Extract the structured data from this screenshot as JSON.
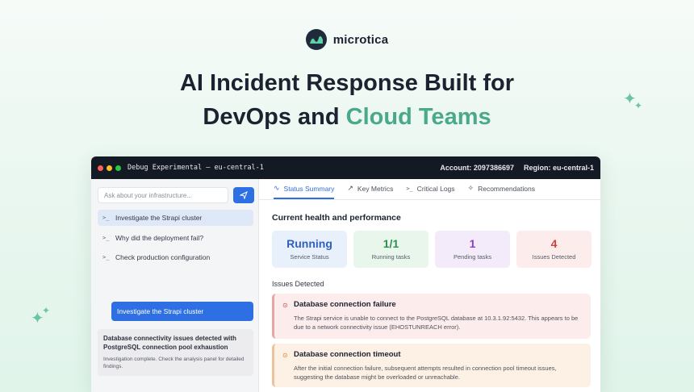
{
  "brand": {
    "name": "microtica"
  },
  "hero": {
    "line1": "AI Incident Response Built for",
    "line2_plain": "DevOps and ",
    "line2_accent": "Cloud Teams"
  },
  "colors": {
    "accent": "#4aa98a",
    "primary_blue": "#2f6fe4",
    "titlebar": "#141a24"
  },
  "window": {
    "title": "Debug Experimental — eu-central-1",
    "account": "Account: 2097386697",
    "region": "Region: eu-central-1",
    "traffic_lights": [
      "#ff5f57",
      "#febc2e",
      "#28c840"
    ]
  },
  "chat": {
    "search_placeholder": "Ask about your infrastructure...",
    "suggestions": [
      {
        "prompt": ">_",
        "label": "Investigate the Strapi cluster",
        "active": true
      },
      {
        "prompt": ">_",
        "label": "Why did the deployment fail?",
        "active": false
      },
      {
        "prompt": ">_",
        "label": "Check production configuration",
        "active": false
      }
    ],
    "user_message": "Investigate the Strapi cluster",
    "reply": {
      "title": "Database connectivity issues detected with PostgreSQL connection pool exhaustion",
      "subtitle": "Investigation complete. Check the analysis panel for detailed findings."
    }
  },
  "tabs": [
    {
      "icon": "pulse-icon",
      "label": "Status Summary",
      "active": true
    },
    {
      "icon": "trend-icon",
      "label": "Key Metrics",
      "active": false
    },
    {
      "icon": "terminal-icon",
      "label": "Critical Logs",
      "active": false
    },
    {
      "icon": "sparkle-icon",
      "label": "Recommendations",
      "active": false
    }
  ],
  "summary": {
    "title": "Current health and performance",
    "cards": [
      {
        "value": "Running",
        "label": "Service Status",
        "color": "#2f5fbf",
        "bg": "#e8f0fb"
      },
      {
        "value": "1/1",
        "label": "Running tasks",
        "color": "#2f8f52",
        "bg": "#e8f6ec"
      },
      {
        "value": "1",
        "label": "Pending tasks",
        "color": "#8a3fbf",
        "bg": "#f3ebfa"
      },
      {
        "value": "4",
        "label": "Issues Detected",
        "color": "#d23f3f",
        "bg": "#fdecec"
      }
    ]
  },
  "issues": {
    "label": "Issues Detected",
    "items": [
      {
        "title": "Database connection failure",
        "description": "The Strapi service is unable to connect to the PostgreSQL database at 10.3.1.92:5432. This appears to be due to a network connectivity issue (EHOSTUNREACH error).",
        "icon_color": "#d23f3f"
      },
      {
        "title": "Database connection timeout",
        "description": "After the initial connection failure, subsequent attempts resulted in connection pool timeout issues, suggesting the database might be overloaded or unreachable.",
        "icon_color": "#d9822b"
      }
    ]
  }
}
